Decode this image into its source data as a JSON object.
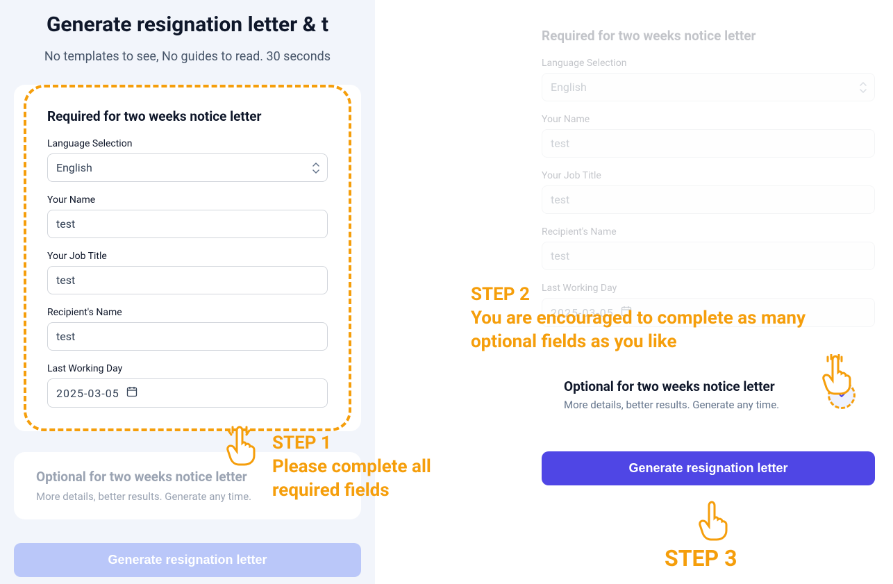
{
  "heading": "Generate resignation letter & t",
  "subheading": "No templates to see, No guides to read. 30 seconds",
  "required_section_title": "Required for two weeks notice letter",
  "fields": {
    "language_label": "Language Selection",
    "language_value": "English",
    "name_label": "Your Name",
    "name_value": "test",
    "job_label": "Your Job Title",
    "job_value": "test",
    "recipient_label": "Recipient's Name",
    "recipient_value": "test",
    "lastday_label": "Last Working Day",
    "lastday_value": "2025-03-05"
  },
  "optional_title": "Optional for two weeks notice letter",
  "optional_sub": "More details, better results. Generate any time.",
  "generate_label": "Generate resignation letter",
  "anno": {
    "step1_title": "STEP 1",
    "step1_text": "Please complete all required fields",
    "step2_title": "STEP 2",
    "step2_text": "You are encouraged to complete as many optional fields as you like",
    "step3_title": "STEP 3"
  }
}
